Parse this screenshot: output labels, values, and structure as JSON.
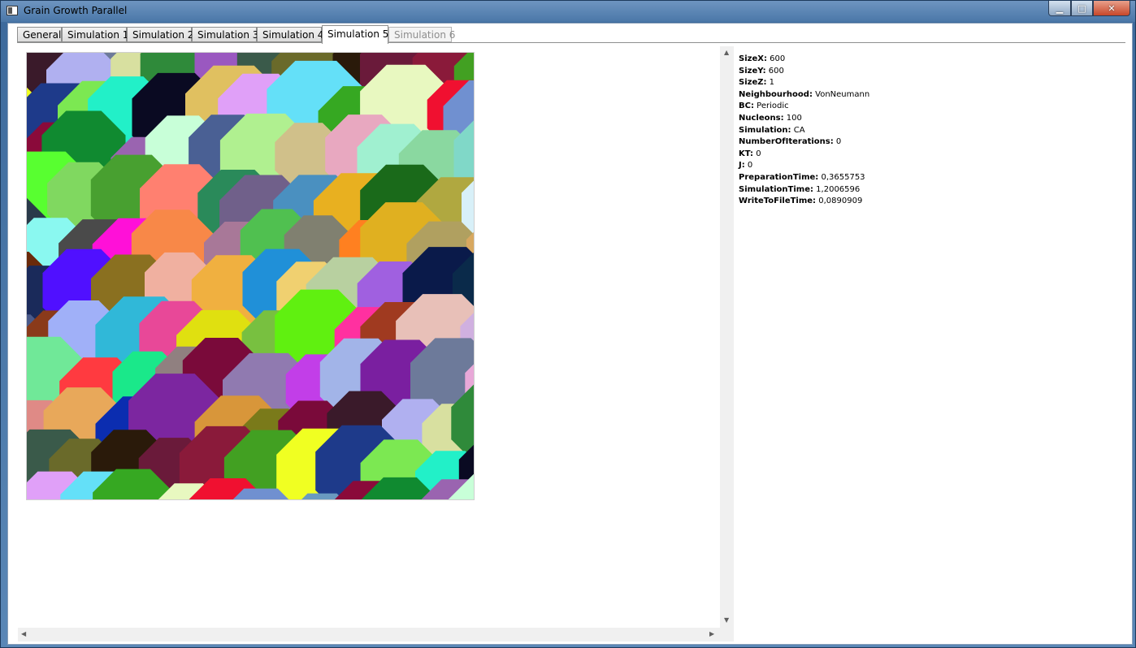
{
  "window": {
    "title": "Grain Growth Parallel",
    "minimize_glyph": "▁",
    "maximize_glyph": "□",
    "close_glyph": "✕"
  },
  "tabs": [
    {
      "label": "General",
      "state": "normal"
    },
    {
      "label": "Simulation 1",
      "state": "normal"
    },
    {
      "label": "Simulation 2",
      "state": "normal"
    },
    {
      "label": "Simulation 3",
      "state": "normal"
    },
    {
      "label": "Simulation 4",
      "state": "normal"
    },
    {
      "label": "Simulation 5",
      "state": "active"
    },
    {
      "label": "Simulation 6",
      "state": "disabled"
    }
  ],
  "info": {
    "rows": [
      {
        "key": "SizeX:",
        "value": "600"
      },
      {
        "key": "SizeY:",
        "value": "600"
      },
      {
        "key": "SizeZ:",
        "value": "1"
      },
      {
        "key": "Neighbourhood:",
        "value": "VonNeumann"
      },
      {
        "key": "BC:",
        "value": "Periodic"
      },
      {
        "key": "Nucleons:",
        "value": "100"
      },
      {
        "key": "Simulation:",
        "value": "CA"
      },
      {
        "key": "NumberOfIterations:",
        "value": "0"
      },
      {
        "key": "KT:",
        "value": "0"
      },
      {
        "key": "J:",
        "value": "0"
      },
      {
        "key": "PreparationTime:",
        "value": "0,3655753"
      },
      {
        "key": "SimulationTime:",
        "value": "1,2006596"
      },
      {
        "key": "WriteToFileTime:",
        "value": "0,0890909"
      }
    ]
  },
  "scroll": {
    "up_arrow": "▲",
    "down_arrow": "▼",
    "left_arrow": "◀",
    "right_arrow": "▶"
  },
  "grain_colors": [
    "#c23ee8",
    "#a2b4e8",
    "#7a1fa0",
    "#6d7a9a",
    "#e8a8d8",
    "#c01aa8",
    "#df8a86",
    "#e8a85a",
    "#0b2db0",
    "#7c26a0",
    "#d8963a",
    "#7a7a1a",
    "#7a0a3a",
    "#3a1a2a",
    "#b0b0f0",
    "#d8e0a0",
    "#2f8a3a",
    "#9a58c0",
    "#3a5a4a",
    "#6a6a2a",
    "#2a1a0a",
    "#6a1a3a",
    "#8a1a3a",
    "#42a022",
    "#f0ff22",
    "#1e3a8a",
    "#7ce852",
    "#22f0c8",
    "#0a0a22",
    "#e0c060",
    "#e0a0f8",
    "#64e0f8",
    "#36a822",
    "#e8f8c0",
    "#f01030",
    "#7090d0",
    "#6a9ac0",
    "#8a0a3a",
    "#108a30",
    "#9a64b0",
    "#c8ffd8",
    "#4a6094",
    "#b0f090",
    "#d0c08a",
    "#e8a8c0",
    "#a0f0d0",
    "#8ad8a0",
    "#80d8c8",
    "#10a030",
    "#58ff30",
    "#80d860",
    "#48a030",
    "#ff8070",
    "#2a8a5a",
    "#70608a",
    "#4a90c0",
    "#e8b020",
    "#1a6a1a",
    "#b0a840",
    "#d8f0f8",
    "#2a3a4a",
    "#8af8f0",
    "#4a4a4a",
    "#ff10d8",
    "#f88848",
    "#a87898",
    "#50c050",
    "#808070",
    "#ff8020",
    "#e0b020",
    "#b0a060",
    "#d8a860",
    "#6a2a0a",
    "#1a2a5a",
    "#5010ff",
    "#8a7020",
    "#f0b0a0",
    "#f0b040",
    "#2090d8",
    "#f0d070",
    "#b8d0a0",
    "#a060e0",
    "#0a1a4a",
    "#0a2a4a",
    "#4a5a8a",
    "#8a3a1a",
    "#a0b0f8",
    "#30b8d8",
    "#e84898",
    "#e0e010",
    "#78c040",
    "#60f010",
    "#ff30a0",
    "#a03a20",
    "#e8c0b8",
    "#d0b0e0",
    "#e8b060",
    "#70e898",
    "#ff3a40",
    "#1ae88a",
    "#908080",
    "#7a0a3a",
    "#907ab0"
  ]
}
